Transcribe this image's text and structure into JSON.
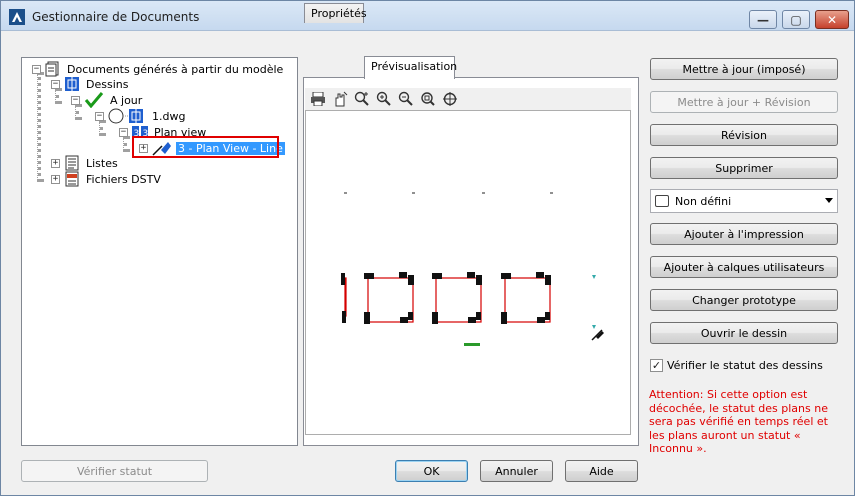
{
  "window": {
    "title": "Gestionnaire de Documents",
    "controls": {
      "minimize": "—",
      "maximize": "▢",
      "close": "✕"
    }
  },
  "tree": {
    "root": "Documents générés à partir du modèle",
    "dessins": "Dessins",
    "a_jour": "A jour",
    "file": "1.dwg",
    "plan_view": "Plan view",
    "selected": "3 - Plan View - Line",
    "listes": "Listes",
    "fichiers_dstv": "Fichiers DSTV"
  },
  "tabs": [
    "Propriétés",
    "Prévisualisation"
  ],
  "toolbar": {
    "icons": [
      "printer-icon",
      "pan-icon",
      "zoom-selection-icon",
      "zoom-in-icon",
      "zoom-out-icon",
      "zoom-fit-icon",
      "zoom-all-icon"
    ]
  },
  "buttons": {
    "update_forced": "Mettre à jour (imposé)",
    "update_revision": "Mettre à jour + Révision",
    "revision": "Révision",
    "delete": "Supprimer",
    "add_print": "Ajouter à l'impression",
    "add_layers": "Ajouter à calques utilisateurs",
    "change_prototype": "Changer prototype",
    "open_drawing": "Ouvrir le dessin",
    "verify_status": "Vérifier statut",
    "ok": "OK",
    "cancel": "Annuler",
    "help": "Aide"
  },
  "combo": {
    "value": "Non défini"
  },
  "check": {
    "label": "Vérifier le statut des dessins",
    "checked": true
  },
  "warning": "Attention: Si cette option est décochée, le statut des plans ne sera pas vérifié en temps réel et les plans auront un statut « Inconnu ».",
  "colors": {
    "warning": "#e00000",
    "selection": "#3399ff",
    "highlight": "#e00000"
  }
}
